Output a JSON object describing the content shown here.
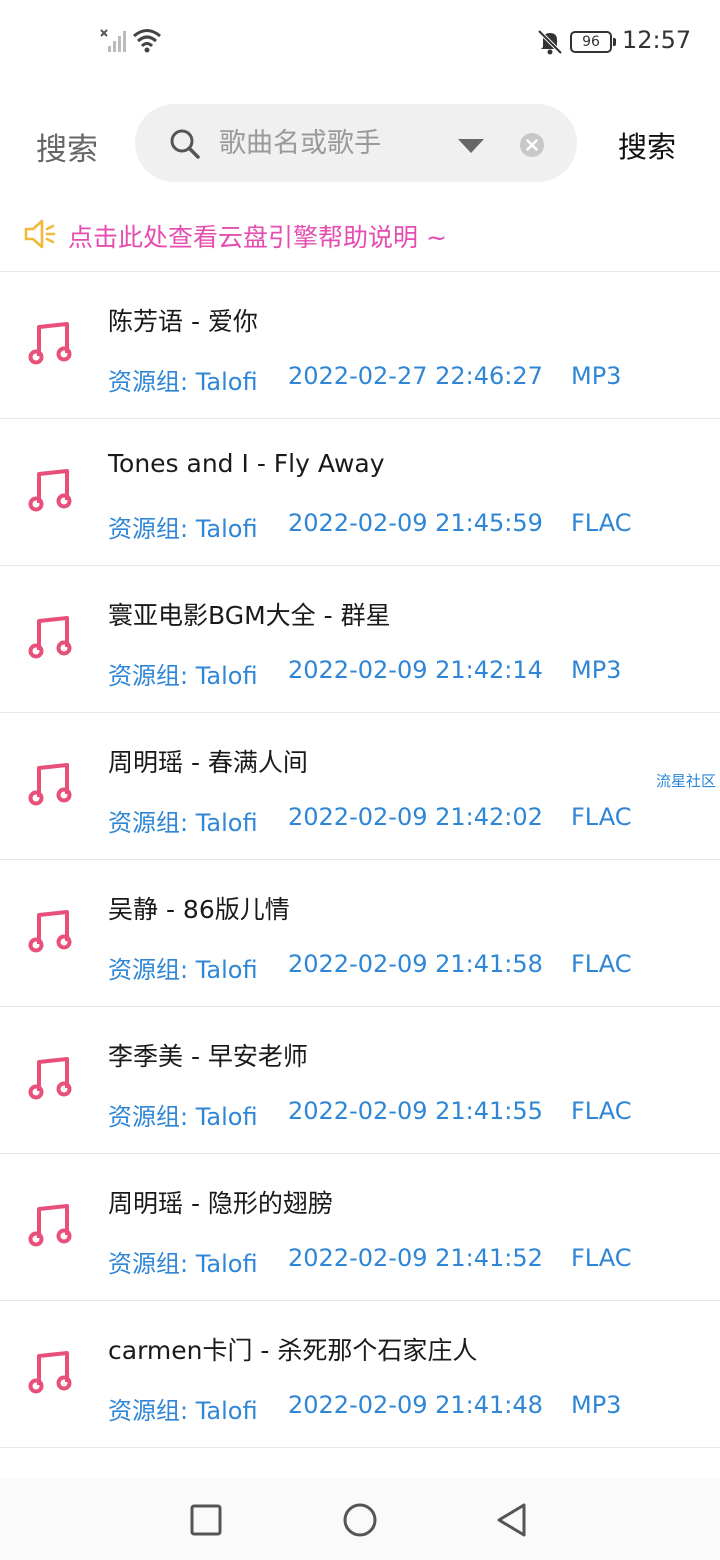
{
  "status_bar": {
    "battery": "96",
    "time": "12:57"
  },
  "search": {
    "title": "搜索",
    "placeholder": "歌曲名或歌手",
    "button_label": "搜索"
  },
  "notice": {
    "text": "点击此处查看云盘引擎帮助说明 ~"
  },
  "songs": [
    {
      "title": "陈芳语 - 爱你",
      "group": "资源组:  Talofi",
      "time": "2022-02-27 22:46:27",
      "format": "MP3"
    },
    {
      "title": "Tones and I - Fly Away",
      "group": "资源组:  Talofi",
      "time": "2022-02-09 21:45:59",
      "format": "FLAC"
    },
    {
      "title": "寰亚电影BGM大全 - 群星",
      "group": "资源组:  Talofi",
      "time": "2022-02-09 21:42:14",
      "format": "MP3"
    },
    {
      "title": "周明瑶 - 春满人间",
      "group": "资源组:  Talofi",
      "time": "2022-02-09 21:42:02",
      "format": "FLAC"
    },
    {
      "title": "吴静 - 86版儿情",
      "group": "资源组:  Talofi",
      "time": "2022-02-09 21:41:58",
      "format": "FLAC"
    },
    {
      "title": "李季美 - 早安老师",
      "group": "资源组:  Talofi",
      "time": "2022-02-09 21:41:55",
      "format": "FLAC"
    },
    {
      "title": "周明瑶 - 隐形的翅膀",
      "group": "资源组:  Talofi",
      "time": "2022-02-09 21:41:52",
      "format": "FLAC"
    },
    {
      "title": "carmen卡门 - 杀死那个石家庄人",
      "group": "资源组:  Talofi",
      "time": "2022-02-09 21:41:48",
      "format": "MP3"
    }
  ],
  "side_label": "流星社区",
  "colors": {
    "accent_blue": "#2f86d6",
    "notice_pink": "#e64db0",
    "note_icon": "#e8507a",
    "speaker_icon": "#f0b93a"
  },
  "icons": {
    "song": "music-note-icon",
    "notice": "speaker-icon",
    "search": "search-icon",
    "dropdown": "dropdown-triangle-icon",
    "clear": "clear-icon"
  }
}
